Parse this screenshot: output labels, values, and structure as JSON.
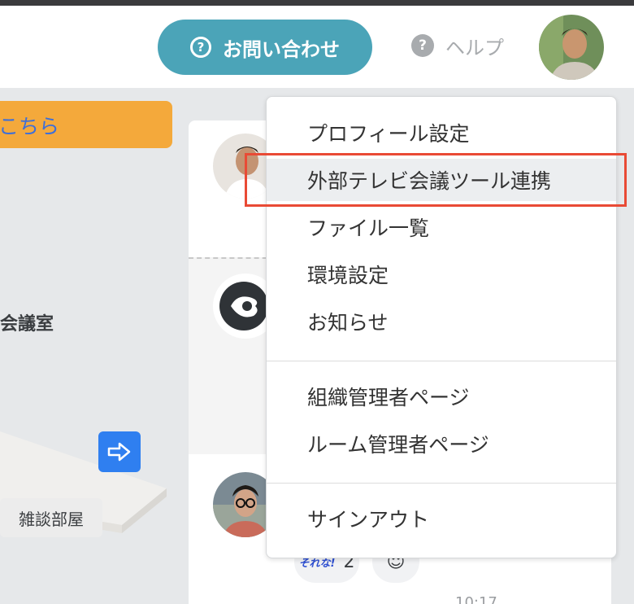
{
  "header": {
    "contact_label": "お問い合わせ",
    "contact_icon": "?",
    "help_label": "ヘルプ",
    "help_icon": "?"
  },
  "background": {
    "banner_text": "こちら",
    "room_label": "会議室",
    "room_name": "雑談部屋"
  },
  "feed": {
    "reaction_stamp": "それな!",
    "reaction_count": "2",
    "emoji_button": "☺",
    "clipped_time": "10:17"
  },
  "menu": {
    "group1": [
      {
        "label": "プロフィール設定"
      },
      {
        "label": "外部テレビ会議ツール連携"
      },
      {
        "label": "ファイル一覧"
      },
      {
        "label": "環境設定"
      },
      {
        "label": "お知らせ"
      }
    ],
    "group2": [
      {
        "label": "組織管理者ページ"
      },
      {
        "label": "ルーム管理者ページ"
      }
    ],
    "group3": [
      {
        "label": "サインアウト"
      }
    ]
  },
  "colors": {
    "accent": "#4ba4b8",
    "highlight": "#e94a35",
    "banner": "#f4a93b",
    "enter_button": "#2f7ff0"
  }
}
